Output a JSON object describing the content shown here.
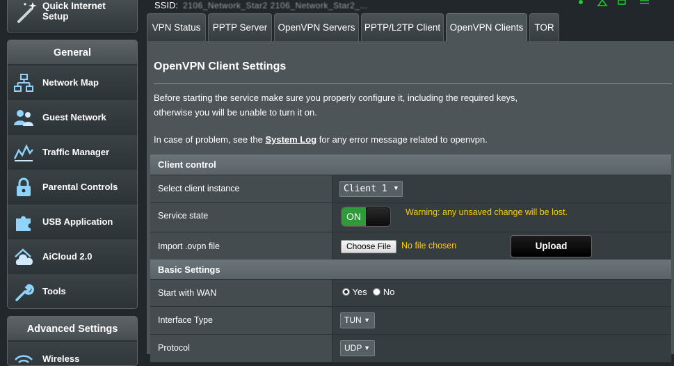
{
  "sidebar": {
    "quick_setup_label": "Quick Internet Setup",
    "general_header": "General",
    "general_items": [
      {
        "label": "Network Map",
        "icon": "network-map-icon"
      },
      {
        "label": "Guest Network",
        "icon": "guest-network-icon"
      },
      {
        "label": "Traffic Manager",
        "icon": "traffic-manager-icon"
      },
      {
        "label": "Parental Controls",
        "icon": "parental-controls-icon"
      },
      {
        "label": "USB Application",
        "icon": "usb-application-icon"
      },
      {
        "label": "AiCloud 2.0",
        "icon": "aicloud-icon"
      },
      {
        "label": "Tools",
        "icon": "tools-icon"
      }
    ],
    "advanced_header": "Advanced Settings",
    "advanced_first_item": "Wireless"
  },
  "topbar": {
    "ssid_label": "SSID:",
    "ssid_value": "2106_Network_Star2   2106_Network_Star2_..."
  },
  "tabs": [
    {
      "label": "VPN Status"
    },
    {
      "label": "PPTP Server"
    },
    {
      "label": "OpenVPN Servers"
    },
    {
      "label": "PPTP/L2TP Client"
    },
    {
      "label": "OpenVPN Clients",
      "active": true
    },
    {
      "label": "TOR"
    }
  ],
  "main": {
    "title": "OpenVPN Client Settings",
    "desc_line1": "Before starting the service make sure you properly configure it, including the required keys,",
    "desc_line2": "otherwise you will be unable to turn it on.",
    "hint_prefix": "In case of problem, see the ",
    "hint_link": "System Log",
    "hint_suffix": " for any error message related to openvpn."
  },
  "client_control": {
    "header": "Client control",
    "select_instance_label": "Select client instance",
    "select_instance_value": "Client 1",
    "service_state_label": "Service state",
    "service_state_value": "ON",
    "warning": "Warning: any unsaved change will be lost.",
    "import_label": "Import .ovpn file",
    "choose_file_label": "Choose File",
    "file_status": "No file chosen",
    "upload_label": "Upload"
  },
  "basic_settings": {
    "header": "Basic Settings",
    "start_wan_label": "Start with WAN",
    "start_wan_yes": "Yes",
    "start_wan_no": "No",
    "start_wan_selected": "Yes",
    "interface_type_label": "Interface Type",
    "interface_type_value": "TUN",
    "protocol_label": "Protocol",
    "protocol_value": "UDP"
  },
  "colors": {
    "background": "#21272a",
    "panel": "#4d5558",
    "accent_green": "#2f9a3a",
    "warning_yellow": "#ffcc00",
    "status_green": "#22cc33"
  }
}
